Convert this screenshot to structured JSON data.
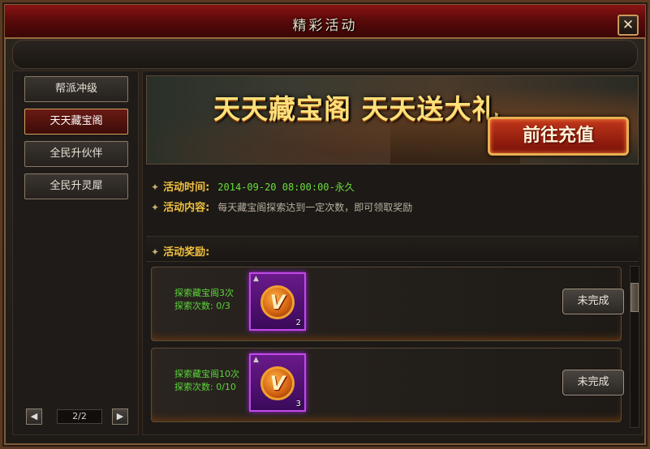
{
  "window": {
    "title": "精彩活动",
    "close_label": "✕"
  },
  "sidebar": {
    "items": [
      {
        "label": "帮派冲级",
        "active": false
      },
      {
        "label": "天天藏宝阁",
        "active": true
      },
      {
        "label": "全民升伙伴",
        "active": false
      },
      {
        "label": "全民升灵犀",
        "active": false
      }
    ],
    "pager": {
      "prev": "◀",
      "page": "2/2",
      "next": "▶"
    }
  },
  "banner": {
    "title": "天天藏宝阁  天天送大礼",
    "recharge_label": "前往充值"
  },
  "activity": {
    "time_label": "活动时间:",
    "time_value": "2014-09-20 08:00:00-永久",
    "content_label": "活动内容:",
    "content_value": "每天藏宝阁探索达到一定次数，即可领取奖励",
    "rewards_label": "活动奖励:",
    "bullet": "✦"
  },
  "rewards": [
    {
      "line1": "探索藏宝阁3次",
      "line2": "探索次数: 0/3",
      "item_glyph": "V",
      "item_count": "2",
      "status": "未完成"
    },
    {
      "line1": "探索藏宝阁10次",
      "line2": "探索次数: 0/10",
      "item_glyph": "V",
      "item_count": "3",
      "status": "未完成"
    }
  ],
  "colors": {
    "accent_gold": "#f0c040",
    "success_green": "#5ad43a",
    "title_red": "#8a1414",
    "item_purple": "#c04ae8"
  }
}
